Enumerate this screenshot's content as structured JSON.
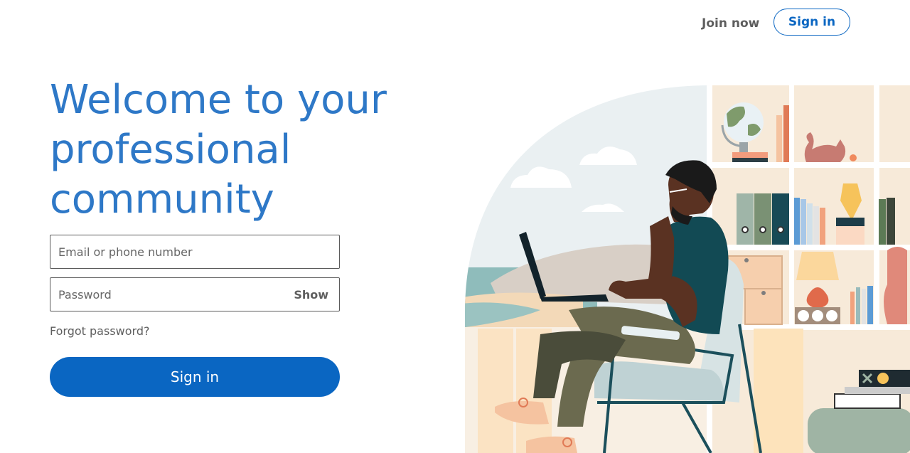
{
  "nav": {
    "join_label": "Join now",
    "signin_label": "Sign in"
  },
  "hero": {
    "headline": "Welcome to your professional community",
    "illustration_icon": "person-working-on-laptop-illustration"
  },
  "form": {
    "email_placeholder": "Email or phone number",
    "email_value": "",
    "password_placeholder": "Password",
    "password_value": "",
    "show_label": "Show",
    "forgot_label": "Forgot password?",
    "submit_label": "Sign in"
  },
  "colors": {
    "brand_blue": "#0a66c2",
    "headline_blue": "#2e78c7",
    "muted_text": "#5e5e5e"
  }
}
